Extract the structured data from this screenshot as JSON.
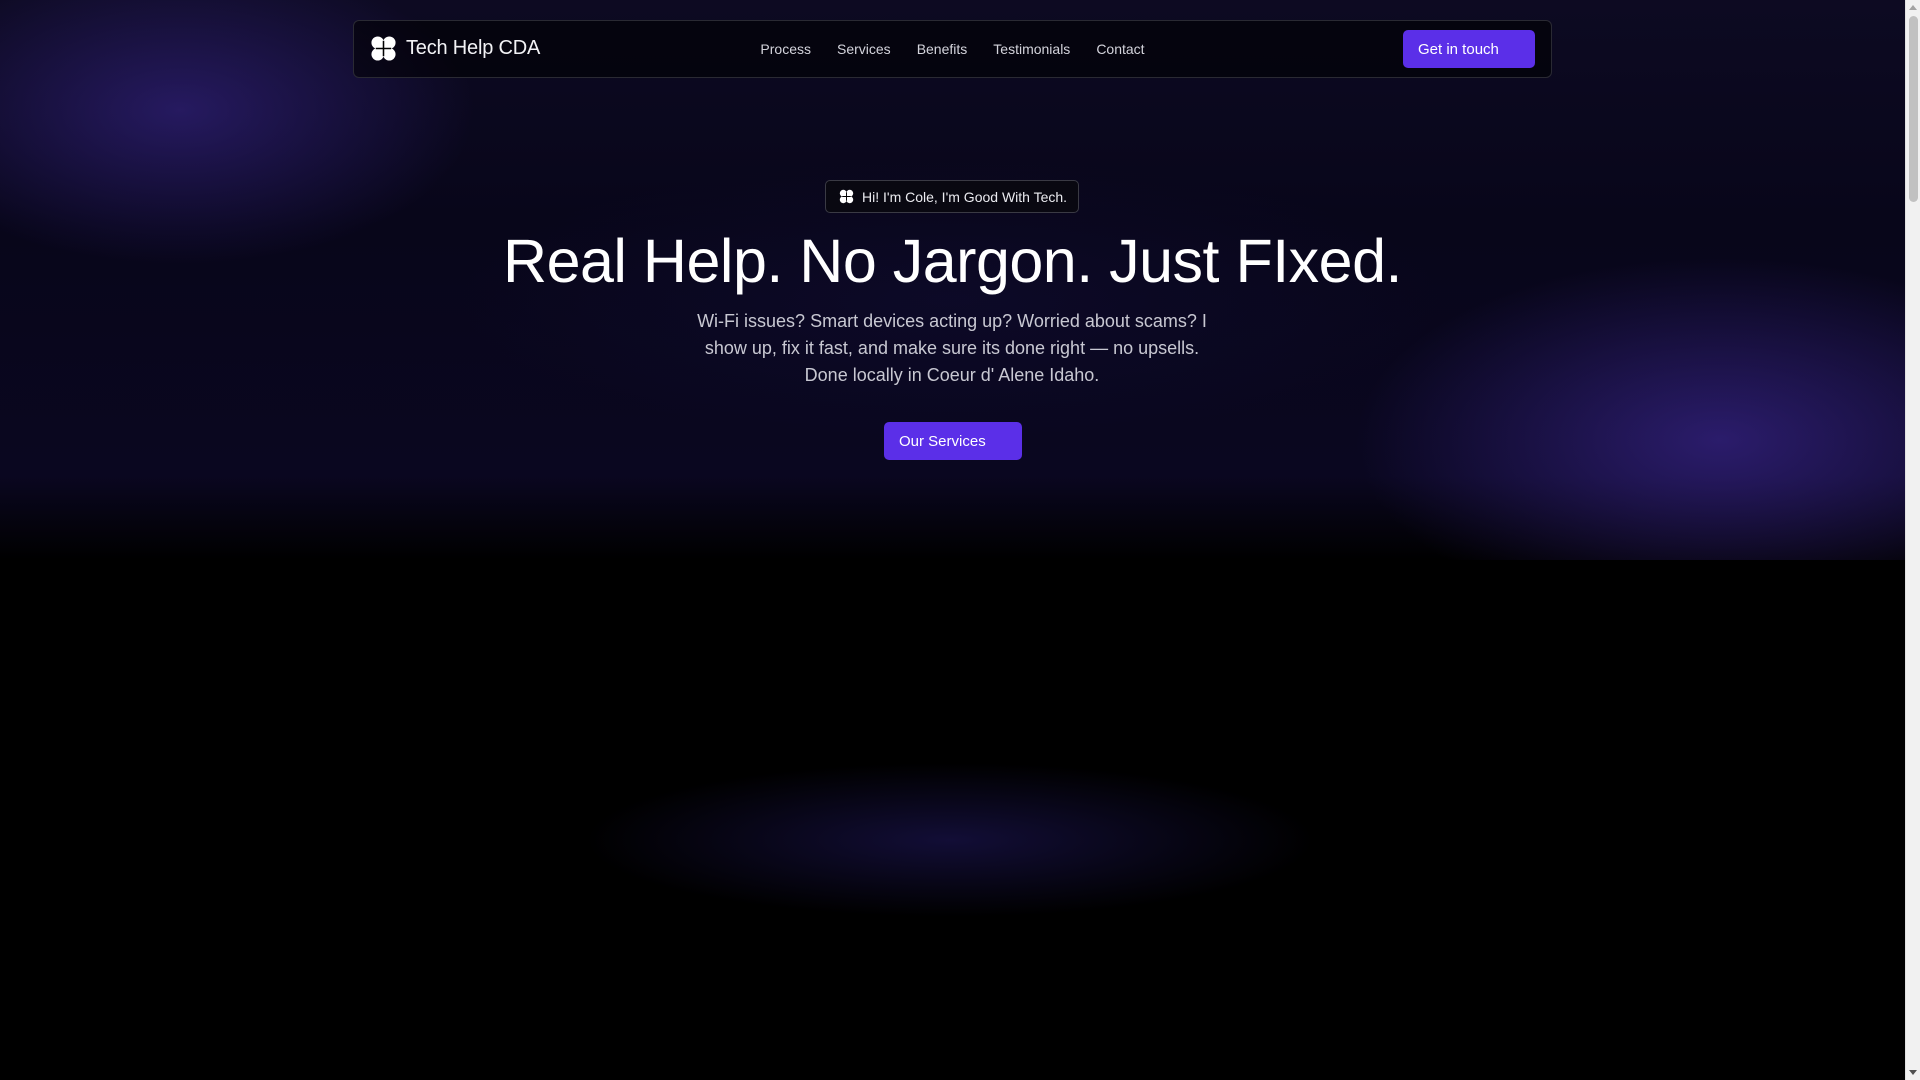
{
  "nav": {
    "brand": "Tech Help CDA",
    "links": [
      "Process",
      "Services",
      "Benefits",
      "Testimonials",
      "Contact"
    ],
    "cta_label": "Get in touch"
  },
  "hero": {
    "badge": "Hi! I'm Cole, I'm Good With Tech.",
    "headline": "Real Help. No Jargon. Just FIxed.",
    "subtext": "Wi-Fi issues? Smart devices acting up? Worried about scams? I show up, fix it fast, and make sure its done right — no upsells. Done locally in Coeur d' Alene Idaho.",
    "cta_label": "Our Services"
  },
  "icons": {
    "logo": "clover-logo-icon"
  },
  "colors": {
    "accent": "#5b2fe8",
    "background": "#000000",
    "glow": "#3c2896"
  }
}
